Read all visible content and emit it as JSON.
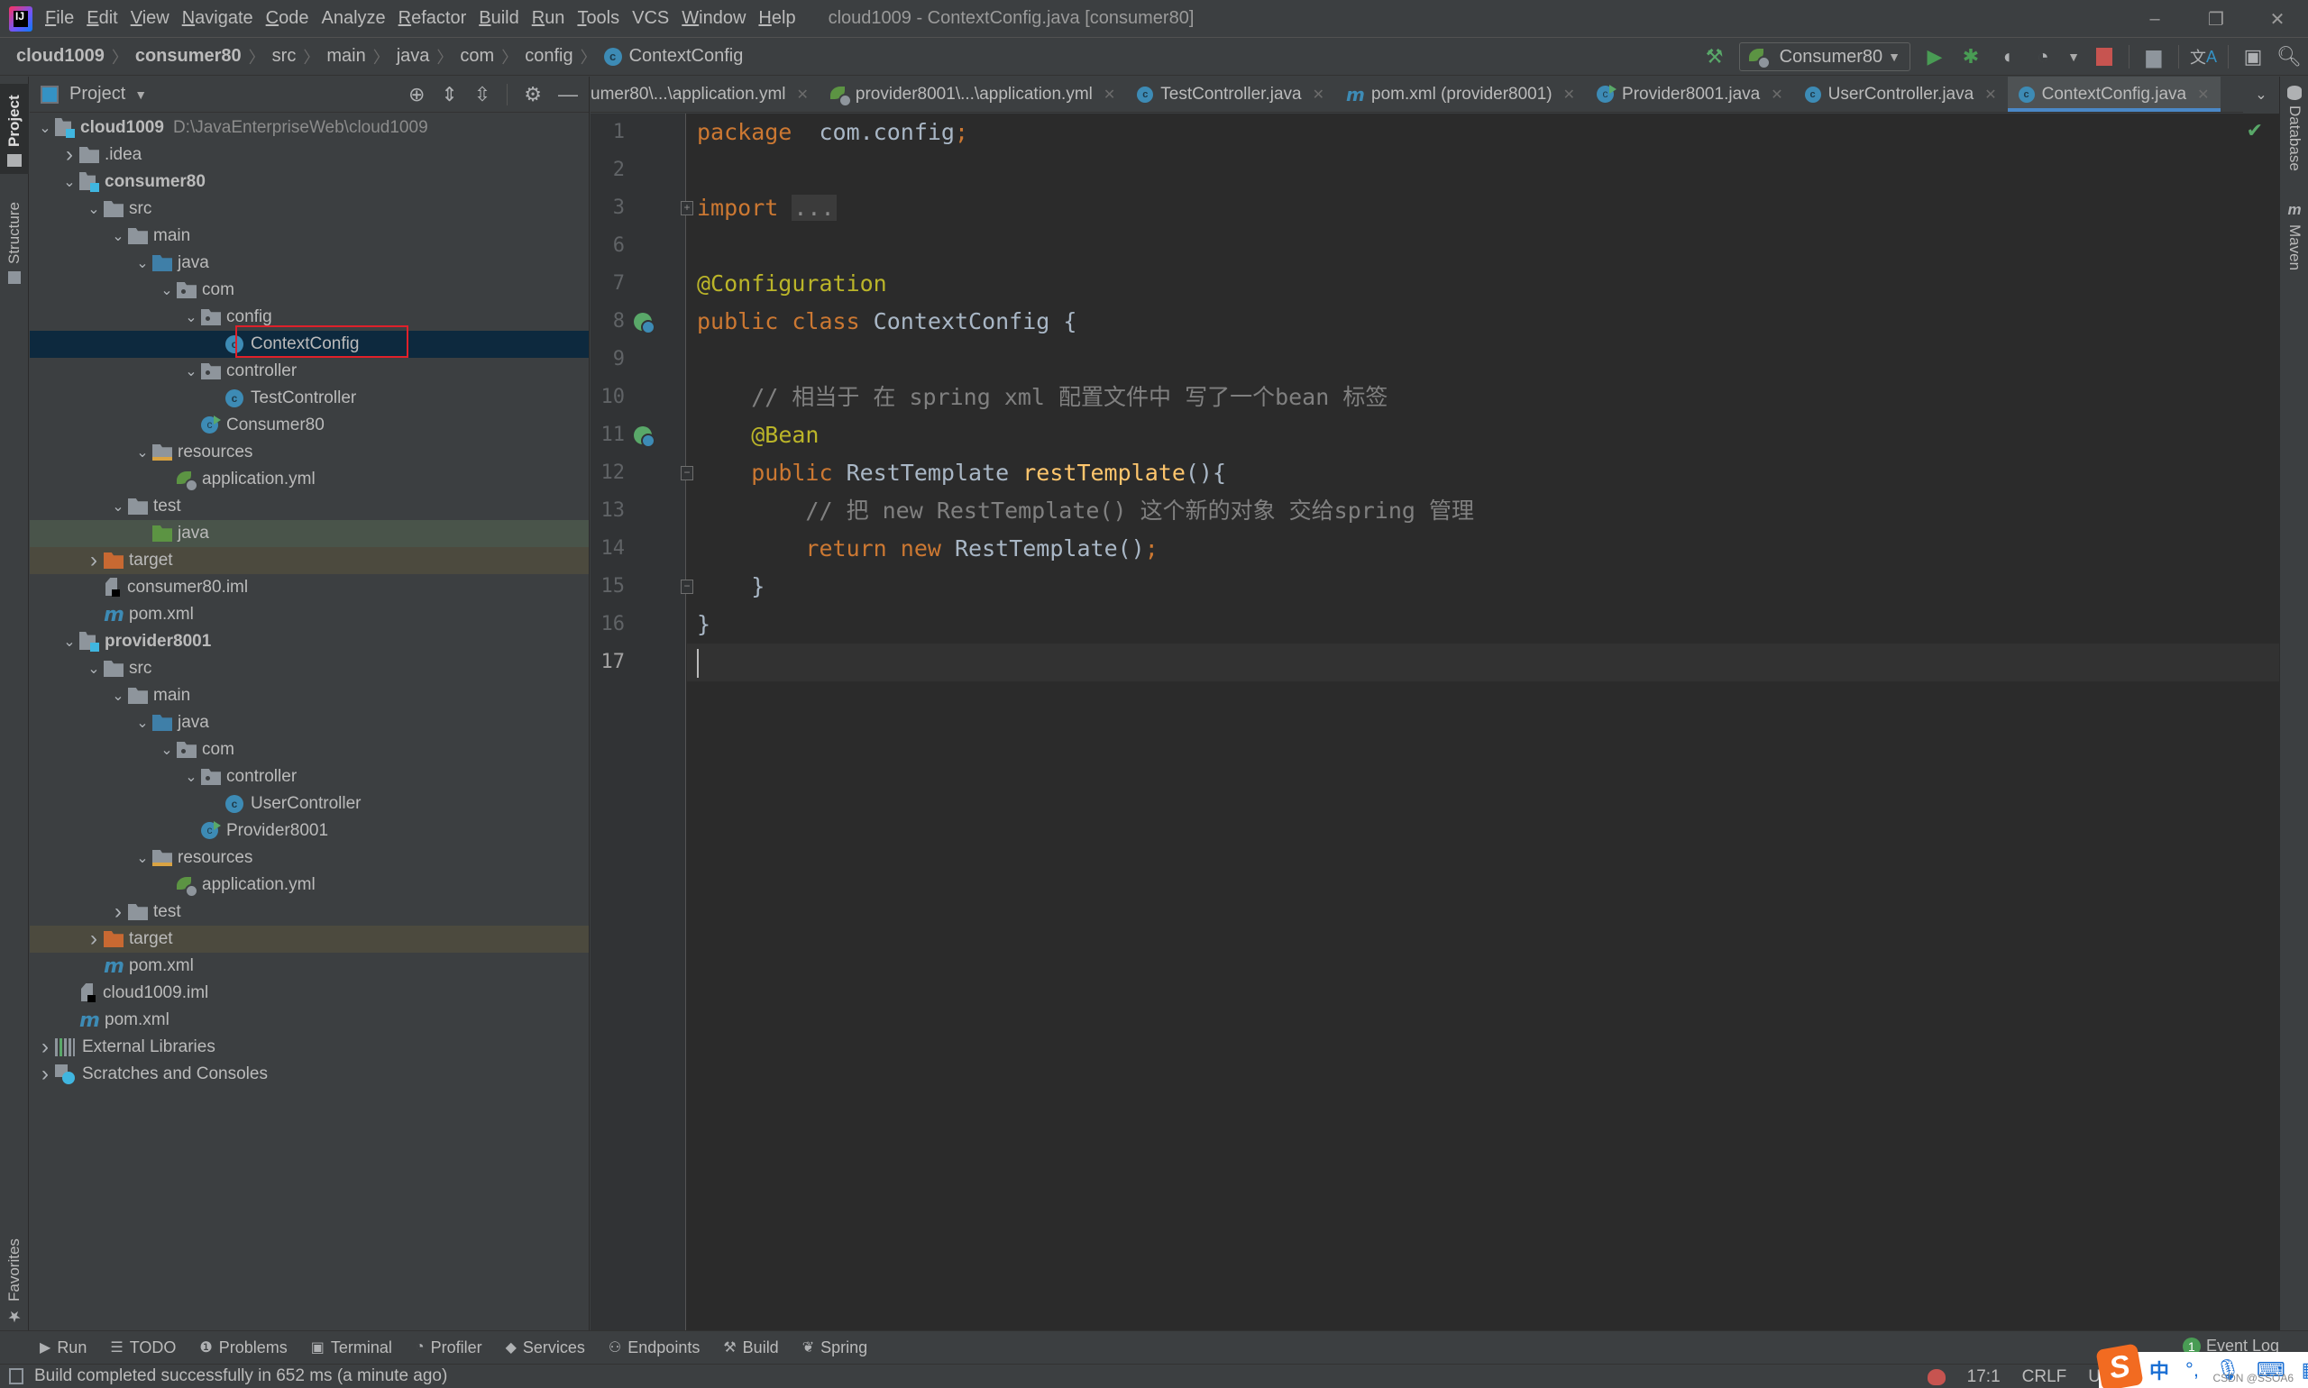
{
  "window": {
    "title": "cloud1009 - ContextConfig.java [consumer80]",
    "controls": {
      "minimize": "–",
      "restore": "❐",
      "close": "✕"
    }
  },
  "menu": [
    {
      "label": "File",
      "mnemonic": "F",
      "rest": "ile"
    },
    {
      "label": "Edit",
      "mnemonic": "E",
      "rest": "dit"
    },
    {
      "label": "View",
      "mnemonic": "V",
      "rest": "iew"
    },
    {
      "label": "Navigate",
      "mnemonic": "N",
      "rest": "avigate"
    },
    {
      "label": "Code",
      "mnemonic": "C",
      "rest": "ode"
    },
    {
      "label": "Analyze",
      "mnemonic": "",
      "rest": "Analyze"
    },
    {
      "label": "Refactor",
      "mnemonic": "R",
      "rest": "efactor"
    },
    {
      "label": "Build",
      "mnemonic": "B",
      "rest": "uild"
    },
    {
      "label": "Run",
      "mnemonic": "R",
      "rest": "un"
    },
    {
      "label": "Tools",
      "mnemonic": "T",
      "rest": "ools"
    },
    {
      "label": "VCS",
      "mnemonic": "",
      "rest": "VCS"
    },
    {
      "label": "Window",
      "mnemonic": "W",
      "rest": "indow"
    },
    {
      "label": "Help",
      "mnemonic": "H",
      "rest": "elp"
    }
  ],
  "breadcrumbs": [
    "cloud1009",
    "consumer80",
    "src",
    "main",
    "java",
    "com",
    "config",
    "ContextConfig"
  ],
  "toolbar": {
    "run_config": "Consumer80",
    "icons": [
      "build-hammer-icon",
      "run-icon",
      "debug-icon",
      "coverage-icon",
      "profile-icon",
      "stop-icon",
      "project-structure-icon",
      "translate-icon",
      "terminal-window-icon",
      "search-icon"
    ]
  },
  "project_panel": {
    "title": "Project",
    "tree": [
      {
        "label": "cloud1009",
        "hint": "D:\\JavaEnterpriseWeb\\cloud1009",
        "depth": 0,
        "arrow": "down",
        "icon": "module",
        "bold": true
      },
      {
        "label": ".idea",
        "depth": 1,
        "arrow": "right",
        "icon": "folder"
      },
      {
        "label": "consumer80",
        "depth": 1,
        "arrow": "down",
        "icon": "module",
        "bold": true
      },
      {
        "label": "src",
        "depth": 2,
        "arrow": "down",
        "icon": "folder"
      },
      {
        "label": "main",
        "depth": 3,
        "arrow": "down",
        "icon": "folder"
      },
      {
        "label": "java",
        "depth": 4,
        "arrow": "down",
        "icon": "folder-blue"
      },
      {
        "label": "com",
        "depth": 5,
        "arrow": "down",
        "icon": "package"
      },
      {
        "label": "config",
        "depth": 6,
        "arrow": "down",
        "icon": "package"
      },
      {
        "label": "ContextConfig",
        "depth": 7,
        "arrow": "none",
        "icon": "class",
        "selected": true
      },
      {
        "label": "controller",
        "depth": 6,
        "arrow": "down",
        "icon": "package"
      },
      {
        "label": "TestController",
        "depth": 7,
        "arrow": "none",
        "icon": "class"
      },
      {
        "label": "Consumer80",
        "depth": 6,
        "arrow": "none",
        "icon": "boot"
      },
      {
        "label": "resources",
        "depth": 4,
        "arrow": "down",
        "icon": "resources"
      },
      {
        "label": "application.yml",
        "depth": 5,
        "arrow": "none",
        "icon": "yml"
      },
      {
        "label": "test",
        "depth": 3,
        "arrow": "down",
        "icon": "folder"
      },
      {
        "label": "java",
        "depth": 4,
        "arrow": "none",
        "icon": "folder-green",
        "row": "green"
      },
      {
        "label": "target",
        "depth": 2,
        "arrow": "right",
        "icon": "folder-orange",
        "row": "brown"
      },
      {
        "label": "consumer80.iml",
        "depth": 2,
        "arrow": "none",
        "icon": "iml"
      },
      {
        "label": "pom.xml",
        "depth": 2,
        "arrow": "none",
        "icon": "maven"
      },
      {
        "label": "provider8001",
        "depth": 1,
        "arrow": "down",
        "icon": "module",
        "bold": true
      },
      {
        "label": "src",
        "depth": 2,
        "arrow": "down",
        "icon": "folder"
      },
      {
        "label": "main",
        "depth": 3,
        "arrow": "down",
        "icon": "folder"
      },
      {
        "label": "java",
        "depth": 4,
        "arrow": "down",
        "icon": "folder-blue"
      },
      {
        "label": "com",
        "depth": 5,
        "arrow": "down",
        "icon": "package"
      },
      {
        "label": "controller",
        "depth": 6,
        "arrow": "down",
        "icon": "package"
      },
      {
        "label": "UserController",
        "depth": 7,
        "arrow": "none",
        "icon": "class"
      },
      {
        "label": "Provider8001",
        "depth": 6,
        "arrow": "none",
        "icon": "boot"
      },
      {
        "label": "resources",
        "depth": 4,
        "arrow": "down",
        "icon": "resources"
      },
      {
        "label": "application.yml",
        "depth": 5,
        "arrow": "none",
        "icon": "yml"
      },
      {
        "label": "test",
        "depth": 3,
        "arrow": "right",
        "icon": "folder"
      },
      {
        "label": "target",
        "depth": 2,
        "arrow": "right",
        "icon": "folder-orange",
        "row": "brown"
      },
      {
        "label": "pom.xml",
        "depth": 2,
        "arrow": "none",
        "icon": "maven"
      },
      {
        "label": "cloud1009.iml",
        "depth": 1,
        "arrow": "none",
        "icon": "iml"
      },
      {
        "label": "pom.xml",
        "depth": 1,
        "arrow": "none",
        "icon": "maven"
      },
      {
        "label": "External Libraries",
        "depth": 0,
        "arrow": "right",
        "icon": "libraries"
      },
      {
        "label": "Scratches and Consoles",
        "depth": 0,
        "arrow": "right",
        "icon": "scratches"
      }
    ]
  },
  "left_strip": [
    "Project",
    "Structure",
    "Favorites"
  ],
  "right_strip": [
    "Database",
    "Maven"
  ],
  "editor_tabs": [
    {
      "label": "umer80\\...\\application.yml",
      "icon": "yml"
    },
    {
      "label": "provider8001\\...\\application.yml",
      "icon": "yml"
    },
    {
      "label": "TestController.java",
      "icon": "class"
    },
    {
      "label": "pom.xml (provider8001)",
      "icon": "maven"
    },
    {
      "label": "Provider8001.java",
      "icon": "boot"
    },
    {
      "label": "UserController.java",
      "icon": "class"
    },
    {
      "label": "ContextConfig.java",
      "icon": "class",
      "active": true
    }
  ],
  "editor": {
    "lines": [
      {
        "num": "1",
        "tokens": [
          [
            "kw",
            "package"
          ],
          [
            "",
            "  com.config"
          ],
          [
            "kw",
            ";"
          ]
        ]
      },
      {
        "num": "2",
        "tokens": []
      },
      {
        "num": "3",
        "tokens": [
          [
            "kw",
            "import"
          ],
          [
            "",
            " "
          ],
          [
            "folded",
            "..."
          ]
        ],
        "fold": "+"
      },
      {
        "num": "6",
        "tokens": []
      },
      {
        "num": "7",
        "tokens": [
          [
            "ann",
            "@Configuration"
          ]
        ]
      },
      {
        "num": "8",
        "tokens": [
          [
            "kw",
            "public class "
          ],
          [
            "",
            "ContextConfig {"
          ]
        ],
        "gutter": "bean"
      },
      {
        "num": "9",
        "tokens": []
      },
      {
        "num": "10",
        "tokens": [
          [
            "cmt",
            "    // 相当于 在 spring xml 配置文件中 写了一个bean 标签"
          ]
        ]
      },
      {
        "num": "11",
        "tokens": [
          [
            "",
            "    "
          ],
          [
            "ann",
            "@Bean"
          ]
        ],
        "gutter": "bean"
      },
      {
        "num": "12",
        "tokens": [
          [
            "",
            "    "
          ],
          [
            "kw",
            "public "
          ],
          [
            "",
            "RestTemplate "
          ],
          [
            "fn",
            "restTemplate"
          ],
          [
            "",
            "(){"
          ]
        ],
        "fold": "-"
      },
      {
        "num": "13",
        "tokens": [
          [
            "cmt",
            "        // 把 new RestTemplate() 这个新的对象 交给spring 管理"
          ]
        ]
      },
      {
        "num": "14",
        "tokens": [
          [
            "",
            "        "
          ],
          [
            "kw",
            "return new "
          ],
          [
            "",
            "RestTemplate()"
          ],
          [
            "kw",
            ";"
          ]
        ]
      },
      {
        "num": "15",
        "tokens": [
          [
            "",
            "    }"
          ]
        ],
        "fold": "-"
      },
      {
        "num": "16",
        "tokens": [
          [
            "",
            "}"
          ]
        ]
      },
      {
        "num": "17",
        "tokens": [],
        "current": true
      }
    ],
    "inspection_status": "ok"
  },
  "bottom_tools": [
    {
      "label": "Run",
      "icon": "run-icon",
      "glyph": "▶"
    },
    {
      "label": "TODO",
      "icon": "todo-icon",
      "glyph": "☰"
    },
    {
      "label": "Problems",
      "icon": "problems-icon",
      "glyph": "❶"
    },
    {
      "label": "Terminal",
      "icon": "terminal-icon",
      "glyph": "▣"
    },
    {
      "label": "Profiler",
      "icon": "profiler-icon",
      "glyph": "◔"
    },
    {
      "label": "Services",
      "icon": "services-icon",
      "glyph": "◆"
    },
    {
      "label": "Endpoints",
      "icon": "endpoints-icon",
      "glyph": "⚇"
    },
    {
      "label": "Build",
      "icon": "build-icon",
      "glyph": "⚒"
    },
    {
      "label": "Spring",
      "icon": "spring-icon",
      "glyph": "❦"
    }
  ],
  "event_log": {
    "label": "Event Log",
    "count": "1"
  },
  "status": {
    "message": "Build completed successfully in 652 ms (a minute ago)",
    "position": "17:1",
    "line_separator": "CRLF",
    "encoding": "U"
  },
  "ime": {
    "mode": "中",
    "punct": "°,",
    "watermark": "CSDN @SSOA6"
  },
  "colors": {
    "accent": "#4a88c7",
    "selection": "#0d293e",
    "highlight_box": "#e0202a",
    "keyword": "#cc7832",
    "annotation": "#bbb529",
    "comment": "#808080",
    "function": "#ffc66d",
    "text": "#a9b7c6"
  }
}
